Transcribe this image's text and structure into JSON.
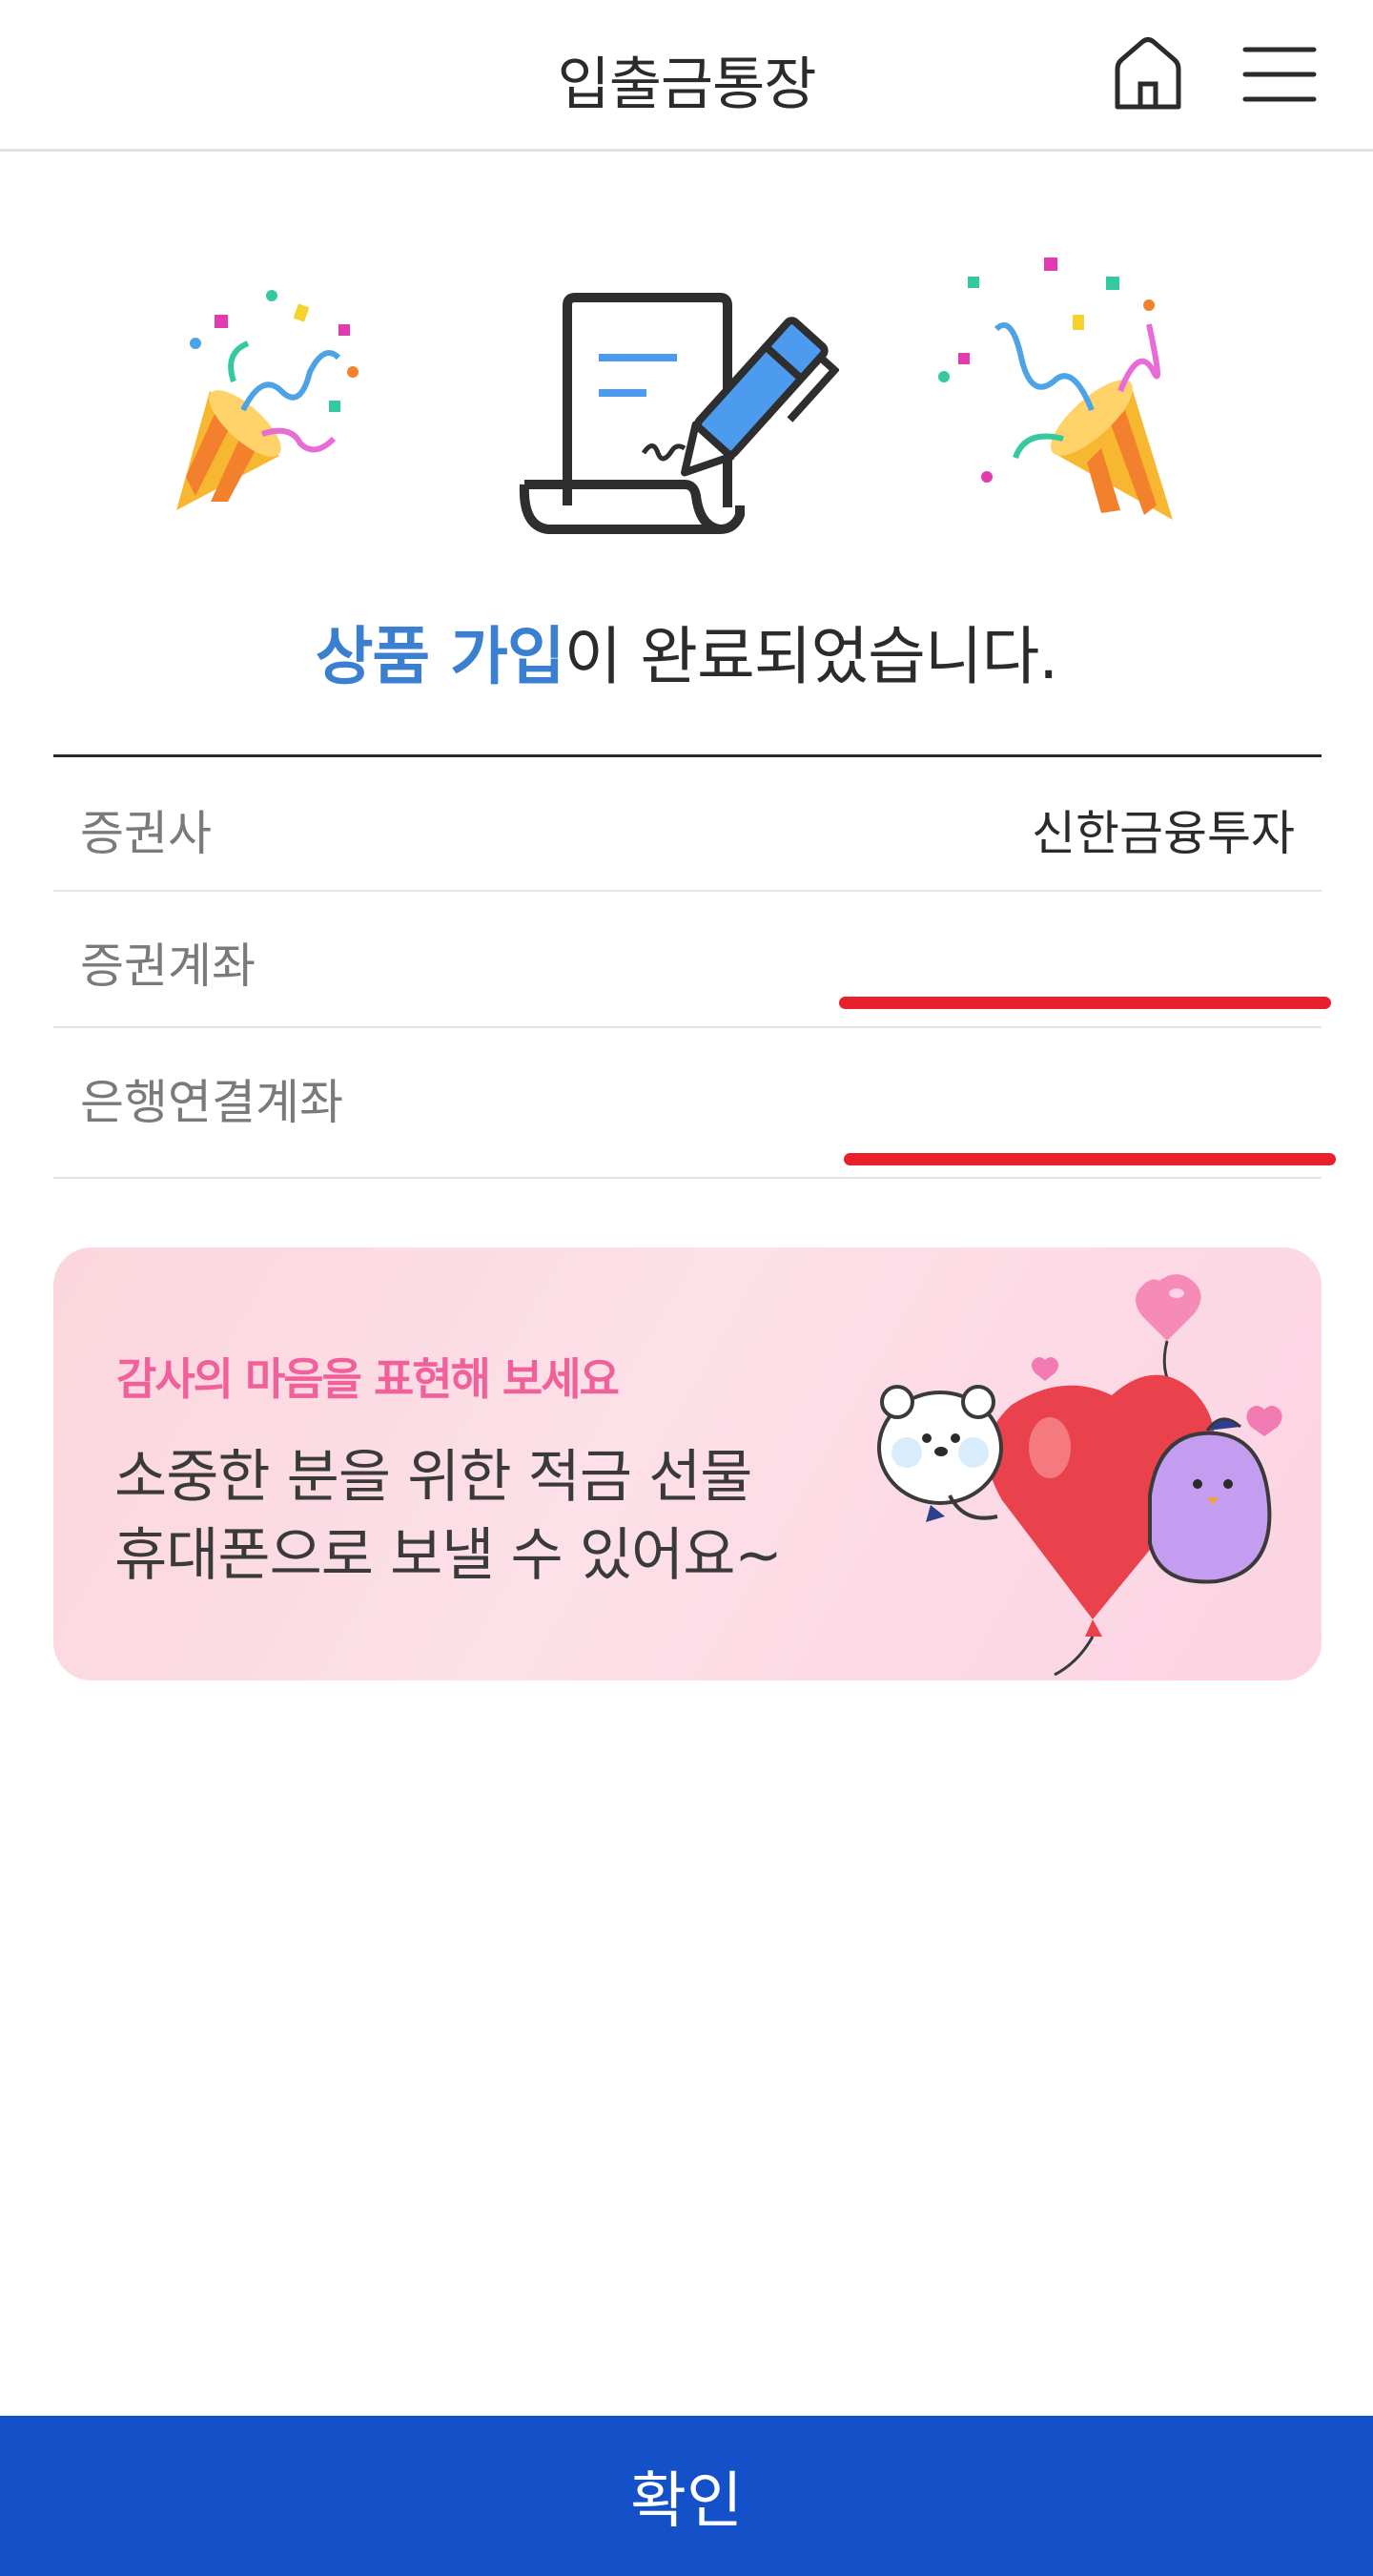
{
  "header": {
    "title": "입출금통장"
  },
  "icons": {
    "home": "home-icon",
    "menu": "hamburger-menu-icon"
  },
  "completion": {
    "highlight": "상품 가입",
    "rest": "이 완료되었습니다."
  },
  "info_rows": [
    {
      "label": "증권사",
      "value": "신한금융투자"
    },
    {
      "label": "증권계좌",
      "value": ""
    },
    {
      "label": "은행연결계좌",
      "value": ""
    }
  ],
  "banner": {
    "kicker": "감사의 마음을 표현해 보세요",
    "line1": "소중한 분을 위한 적금 선물",
    "line2": "휴대폰으로 보낼 수 있어요~"
  },
  "confirm_button": {
    "label": "확인"
  },
  "colors": {
    "accent_blue": "#3b7fd0",
    "button_blue": "#1450c7",
    "banner_kicker_pink": "#f0609a",
    "redaction_red": "#e8202c"
  }
}
